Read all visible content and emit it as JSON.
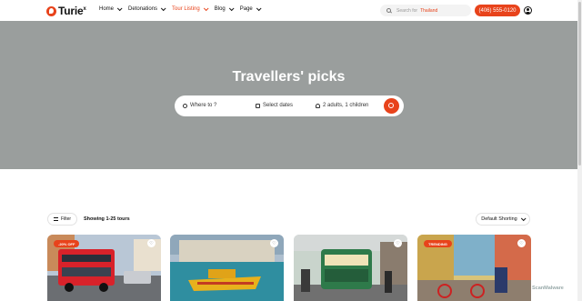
{
  "brand": {
    "name": "Turie",
    "mark": "x"
  },
  "nav": {
    "items": [
      {
        "label": "Home",
        "active": false
      },
      {
        "label": "Detonations",
        "active": false
      },
      {
        "label": "Tour Listing",
        "active": true
      },
      {
        "label": "Blog",
        "active": false
      },
      {
        "label": "Page",
        "active": false
      }
    ],
    "search_placeholder": "Search for",
    "search_value": "Thailand",
    "phone": "(406) 555-0120"
  },
  "hero": {
    "title": "Travellers' picks",
    "where_placeholder": "Where to ?",
    "dates_placeholder": "Select dates",
    "guests": "2 adults, 1 children"
  },
  "listing": {
    "filter_label": "Filter",
    "showing": "Showing 1-25 tours",
    "sort_label": "Default Shorting"
  },
  "cards": [
    {
      "badge": "-20% OFF",
      "badge_color": "#e8431b"
    },
    {
      "badge": "",
      "badge_color": ""
    },
    {
      "badge": "",
      "badge_color": ""
    },
    {
      "badge": "TRENDING",
      "badge_color": "#e8431b"
    }
  ],
  "colors": {
    "accent": "#e8431b",
    "hero_bg": "#9a9e9d"
  }
}
